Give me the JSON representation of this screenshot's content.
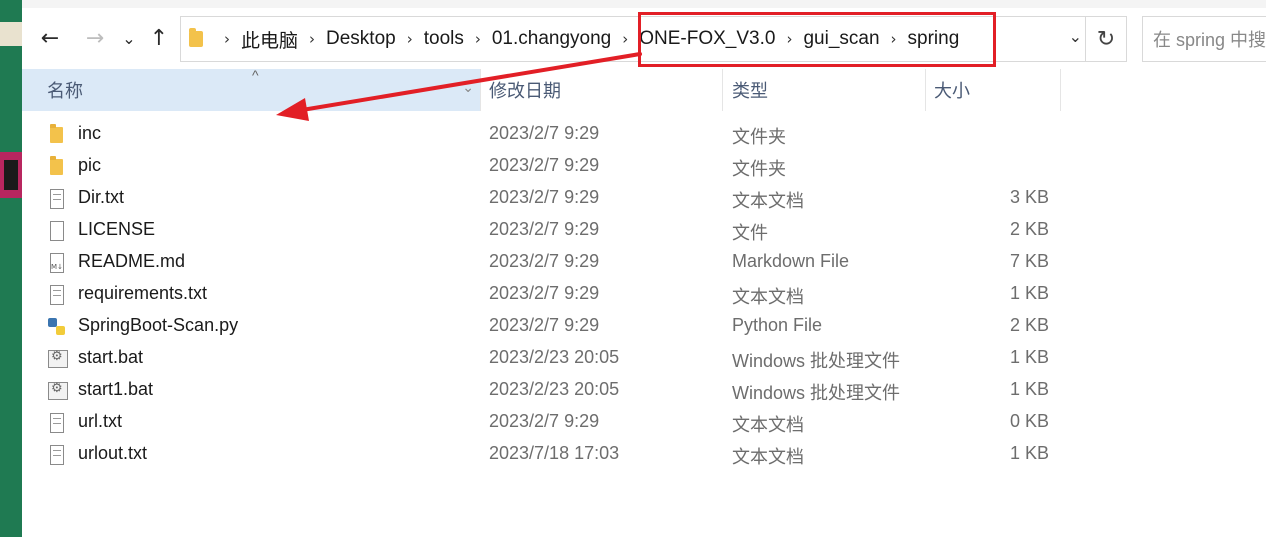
{
  "nav": {
    "back_icon": "←",
    "forward_icon": "→",
    "recent_icon": "⌄",
    "up_icon": "↑"
  },
  "breadcrumb": [
    "此电脑",
    "Desktop",
    "tools",
    "01.changyong",
    "ONE-FOX_V3.0",
    "gui_scan",
    "spring"
  ],
  "address_dropdown_icon": "⌄",
  "refresh_icon": "↻",
  "search": {
    "placeholder": "在 spring 中搜"
  },
  "columns": {
    "name": "名称",
    "date": "修改日期",
    "type": "类型",
    "size": "大小"
  },
  "files": [
    {
      "name": "inc",
      "date": "2023/2/7 9:29",
      "type": "文件夹",
      "size": "",
      "icon": "folder-icon"
    },
    {
      "name": "pic",
      "date": "2023/2/7 9:29",
      "type": "文件夹",
      "size": "",
      "icon": "folder-icon"
    },
    {
      "name": "Dir.txt",
      "date": "2023/2/7 9:29",
      "type": "文本文档",
      "size": "3 KB",
      "icon": "text-file-icon"
    },
    {
      "name": "LICENSE",
      "date": "2023/2/7 9:29",
      "type": "文件",
      "size": "2 KB",
      "icon": "blank-file-icon"
    },
    {
      "name": "README.md",
      "date": "2023/2/7 9:29",
      "type": "Markdown File",
      "size": "7 KB",
      "icon": "markdown-file-icon"
    },
    {
      "name": "requirements.txt",
      "date": "2023/2/7 9:29",
      "type": "文本文档",
      "size": "1 KB",
      "icon": "text-file-icon"
    },
    {
      "name": "SpringBoot-Scan.py",
      "date": "2023/2/7 9:29",
      "type": "Python File",
      "size": "2 KB",
      "icon": "python-file-icon"
    },
    {
      "name": "start.bat",
      "date": "2023/2/23 20:05",
      "type": "Windows 批处理文件",
      "size": "1 KB",
      "icon": "batch-file-icon"
    },
    {
      "name": "start1.bat",
      "date": "2023/2/23 20:05",
      "type": "Windows 批处理文件",
      "size": "1 KB",
      "icon": "batch-file-icon"
    },
    {
      "name": "url.txt",
      "date": "2023/2/7 9:29",
      "type": "文本文档",
      "size": "0 KB",
      "icon": "text-file-icon"
    },
    {
      "name": "urlout.txt",
      "date": "2023/7/18 17:03",
      "type": "文本文档",
      "size": "1 KB",
      "icon": "text-file-icon"
    }
  ],
  "colors": {
    "annotation": "#e21f26",
    "header_selected": "#dbe9f7",
    "folder": "#f3c24b"
  }
}
